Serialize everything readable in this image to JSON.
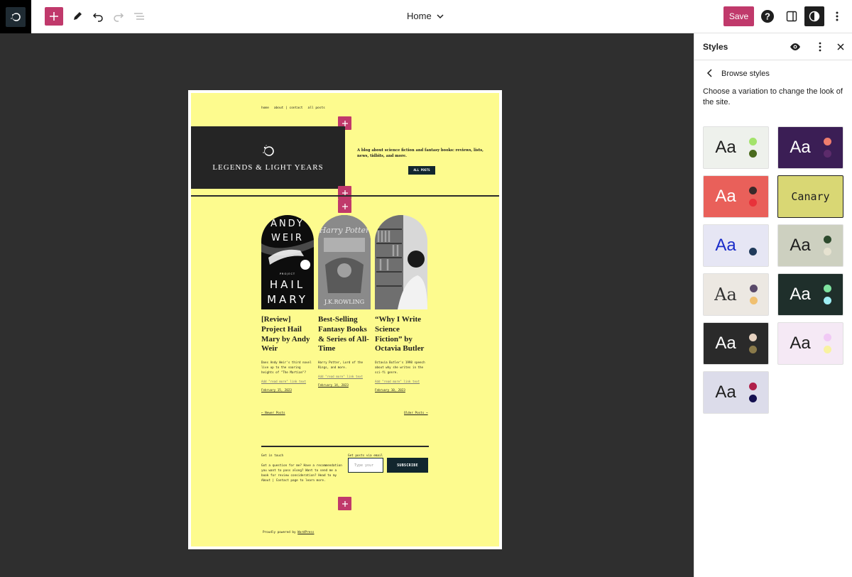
{
  "toolbar": {
    "document_title": "Home",
    "save_label": "Save"
  },
  "site": {
    "nav": [
      "home",
      "about | contact",
      "all posts"
    ],
    "title": "LEGENDS & LIGHT YEARS",
    "tagline": "A blog about science fiction and fantasy books: reviews, lists, news, tidbits, and more.",
    "all_posts_button": "ALL POSTS"
  },
  "posts": [
    {
      "cover_text": [
        "ANDY",
        "WEIR",
        "PROJECT",
        "HAIL",
        "MARY"
      ],
      "title": "[Review] Project Hail Mary by Andy Weir",
      "excerpt": "Does Andy Weir's third novel live up to the soaring heights of \"The Martian\"?",
      "more": "Add \"read more\" link text",
      "date": "February 15, 2023"
    },
    {
      "cover_text": [
        "Harry Potter",
        "J.K.ROWLING"
      ],
      "title": "Best-Selling Fantasy Books & Series of All-Time",
      "excerpt": "Harry Potter, Lord of the Rings, and more.",
      "more": "Add \"read more\" link text",
      "date": "February 14, 2023"
    },
    {
      "cover_text": [],
      "title": "“Why I Write Science Fiction” by Octavia Butler",
      "excerpt": "Octavia Butler's 1998 speech about why she writes in the sci-fi genre.",
      "more": "Add \"read more\" link text",
      "date": "February 10, 2023"
    }
  ],
  "pagination": {
    "newer": "← Newer Posts",
    "older": "Older Posts →"
  },
  "footer": {
    "contact_heading": "Get in touch",
    "contact_text": "Got a question for me? Have a recommendation you want to pass along? Want to send me a book for review consideration? Head to my About | Contact page to learn more.",
    "email_heading": "Get posts via email",
    "email_placeholder": "Type your",
    "subscribe_label": "SUBSCRIBE",
    "powered_prefix": "Proudly powered by ",
    "powered_link": "WordPress"
  },
  "sidebar": {
    "title": "Styles",
    "subtitle": "Browse styles",
    "description": "Choose a variation to change the look of the site.",
    "aa_label": "Aa",
    "selected_label": "Canary"
  },
  "variations": [
    {
      "bg": "#eef1ec",
      "fg": "#1e1e1e",
      "c1": "#a3e36b",
      "c2": "#4a6b1e"
    },
    {
      "bg": "#3b1e55",
      "fg": "#ffffff",
      "c1": "#ef7d6d",
      "c2": "#5c2b6b"
    },
    {
      "bg": "#e9605a",
      "fg": "#ffffff",
      "c1": "#3a2a2a",
      "c2": "#e8323a"
    },
    {
      "bg": "#d9d774",
      "fg": "#1e1e1e",
      "c1": "",
      "c2": "",
      "selected": true
    },
    {
      "bg": "#e6e6f4",
      "fg": "#1a2cc9",
      "c1": "#e6e6f4",
      "c2": "#1f3a5a"
    },
    {
      "bg": "#cdd0c0",
      "fg": "#1e1e1e",
      "c1": "#2d4a2d",
      "c2": "#e6e2d0"
    },
    {
      "bg": "#ece8e2",
      "fg": "#333333",
      "c1": "#5a4a6a",
      "c2": "#f0c070"
    },
    {
      "bg": "#1f2f2b",
      "fg": "#ffffff",
      "c1": "#7fe3a0",
      "c2": "#9feff5"
    },
    {
      "bg": "#2a2a2a",
      "fg": "#ffffff",
      "c1": "#e6d2c0",
      "c2": "#8a7a4a"
    },
    {
      "bg": "#f5e9f5",
      "fg": "#1e1e1e",
      "c1": "#f1c9f5",
      "c2": "#f8f2a0"
    },
    {
      "bg": "#dcdcea",
      "fg": "#1e1e1e",
      "c1": "#b0204a",
      "c2": "#141050"
    }
  ]
}
